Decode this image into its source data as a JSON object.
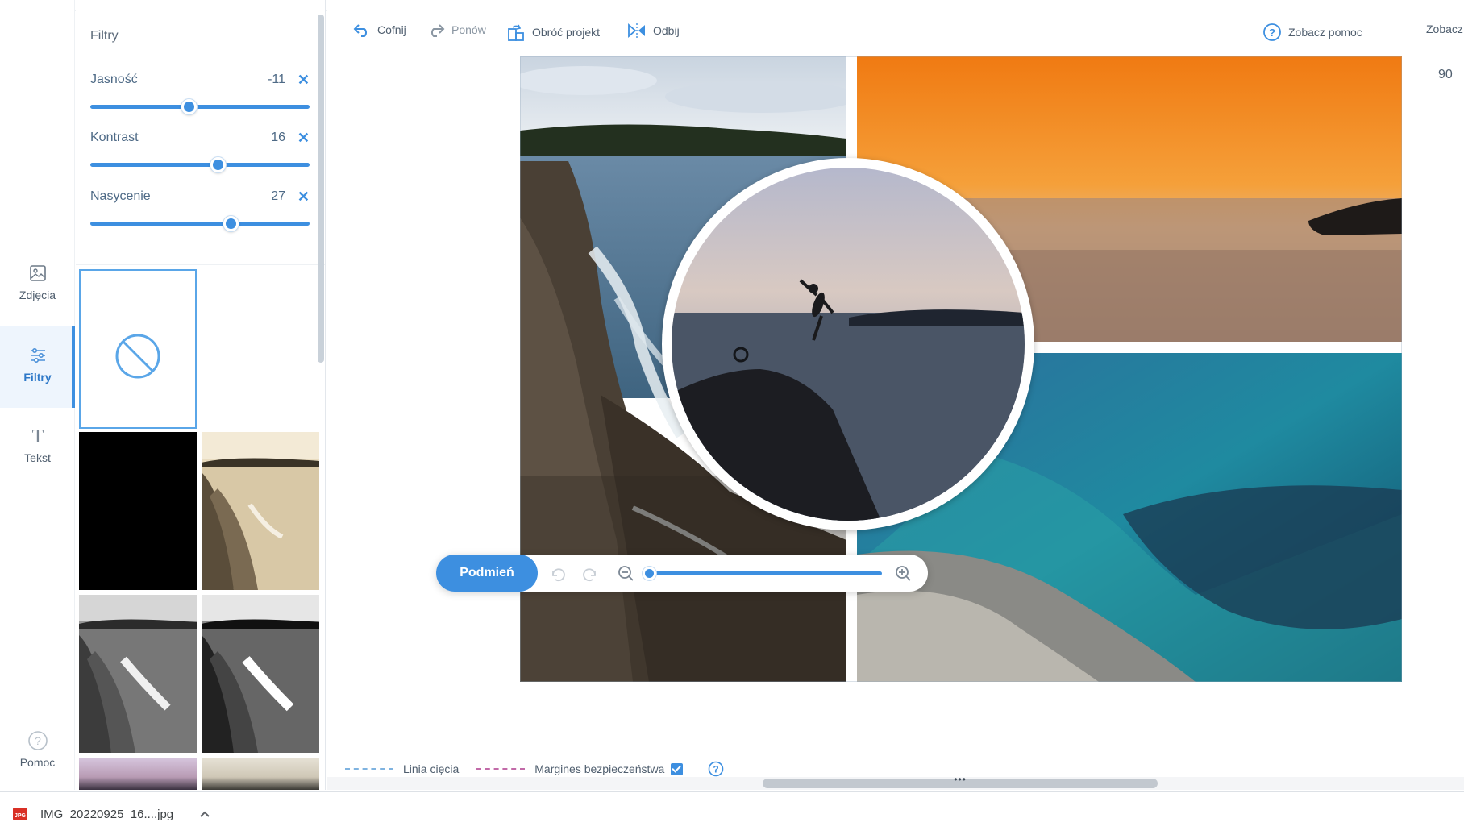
{
  "rail": {
    "items": [
      {
        "label": "Zdjęcia",
        "icon": "image-icon"
      },
      {
        "label": "Filtry",
        "icon": "sliders-icon",
        "active": true
      },
      {
        "label": "Tekst",
        "icon": "text-icon"
      },
      {
        "label": "Pomoc",
        "icon": "help-icon"
      }
    ]
  },
  "filters": {
    "title": "Filtry",
    "sliders": [
      {
        "label": "Jasność",
        "value": "-11",
        "level": 0.45
      },
      {
        "label": "Kontrast",
        "value": "16",
        "level": 0.58
      },
      {
        "label": "Nasycenie",
        "value": "27",
        "level": 0.64
      }
    ],
    "presets": [
      "none",
      "black",
      "sepia",
      "grayscale",
      "grayscale-high-contrast",
      "pink",
      "vintage"
    ]
  },
  "toolbar": {
    "undo": "Cofnij",
    "redo": "Ponów",
    "rotate": "Obróć projekt",
    "flip": "Odbij",
    "help": "Zobacz pomoc",
    "help2": "Zobacz",
    "zoom_readout": "90"
  },
  "image_tools": {
    "swap": "Podmień",
    "zoom_level": 0.0
  },
  "legend": {
    "cut_line": "Linia cięcia",
    "safety_margin": "Margines bezpieczeństwa",
    "safety_checked": true
  },
  "scrollbar": {
    "dots": "•••"
  },
  "downloads": {
    "file": "IMG_20220925_16....jpg"
  },
  "colors": {
    "accent": "#3d8fe0",
    "cut_line": "#7fb3e0",
    "safety_margin": "#c26aa8"
  }
}
